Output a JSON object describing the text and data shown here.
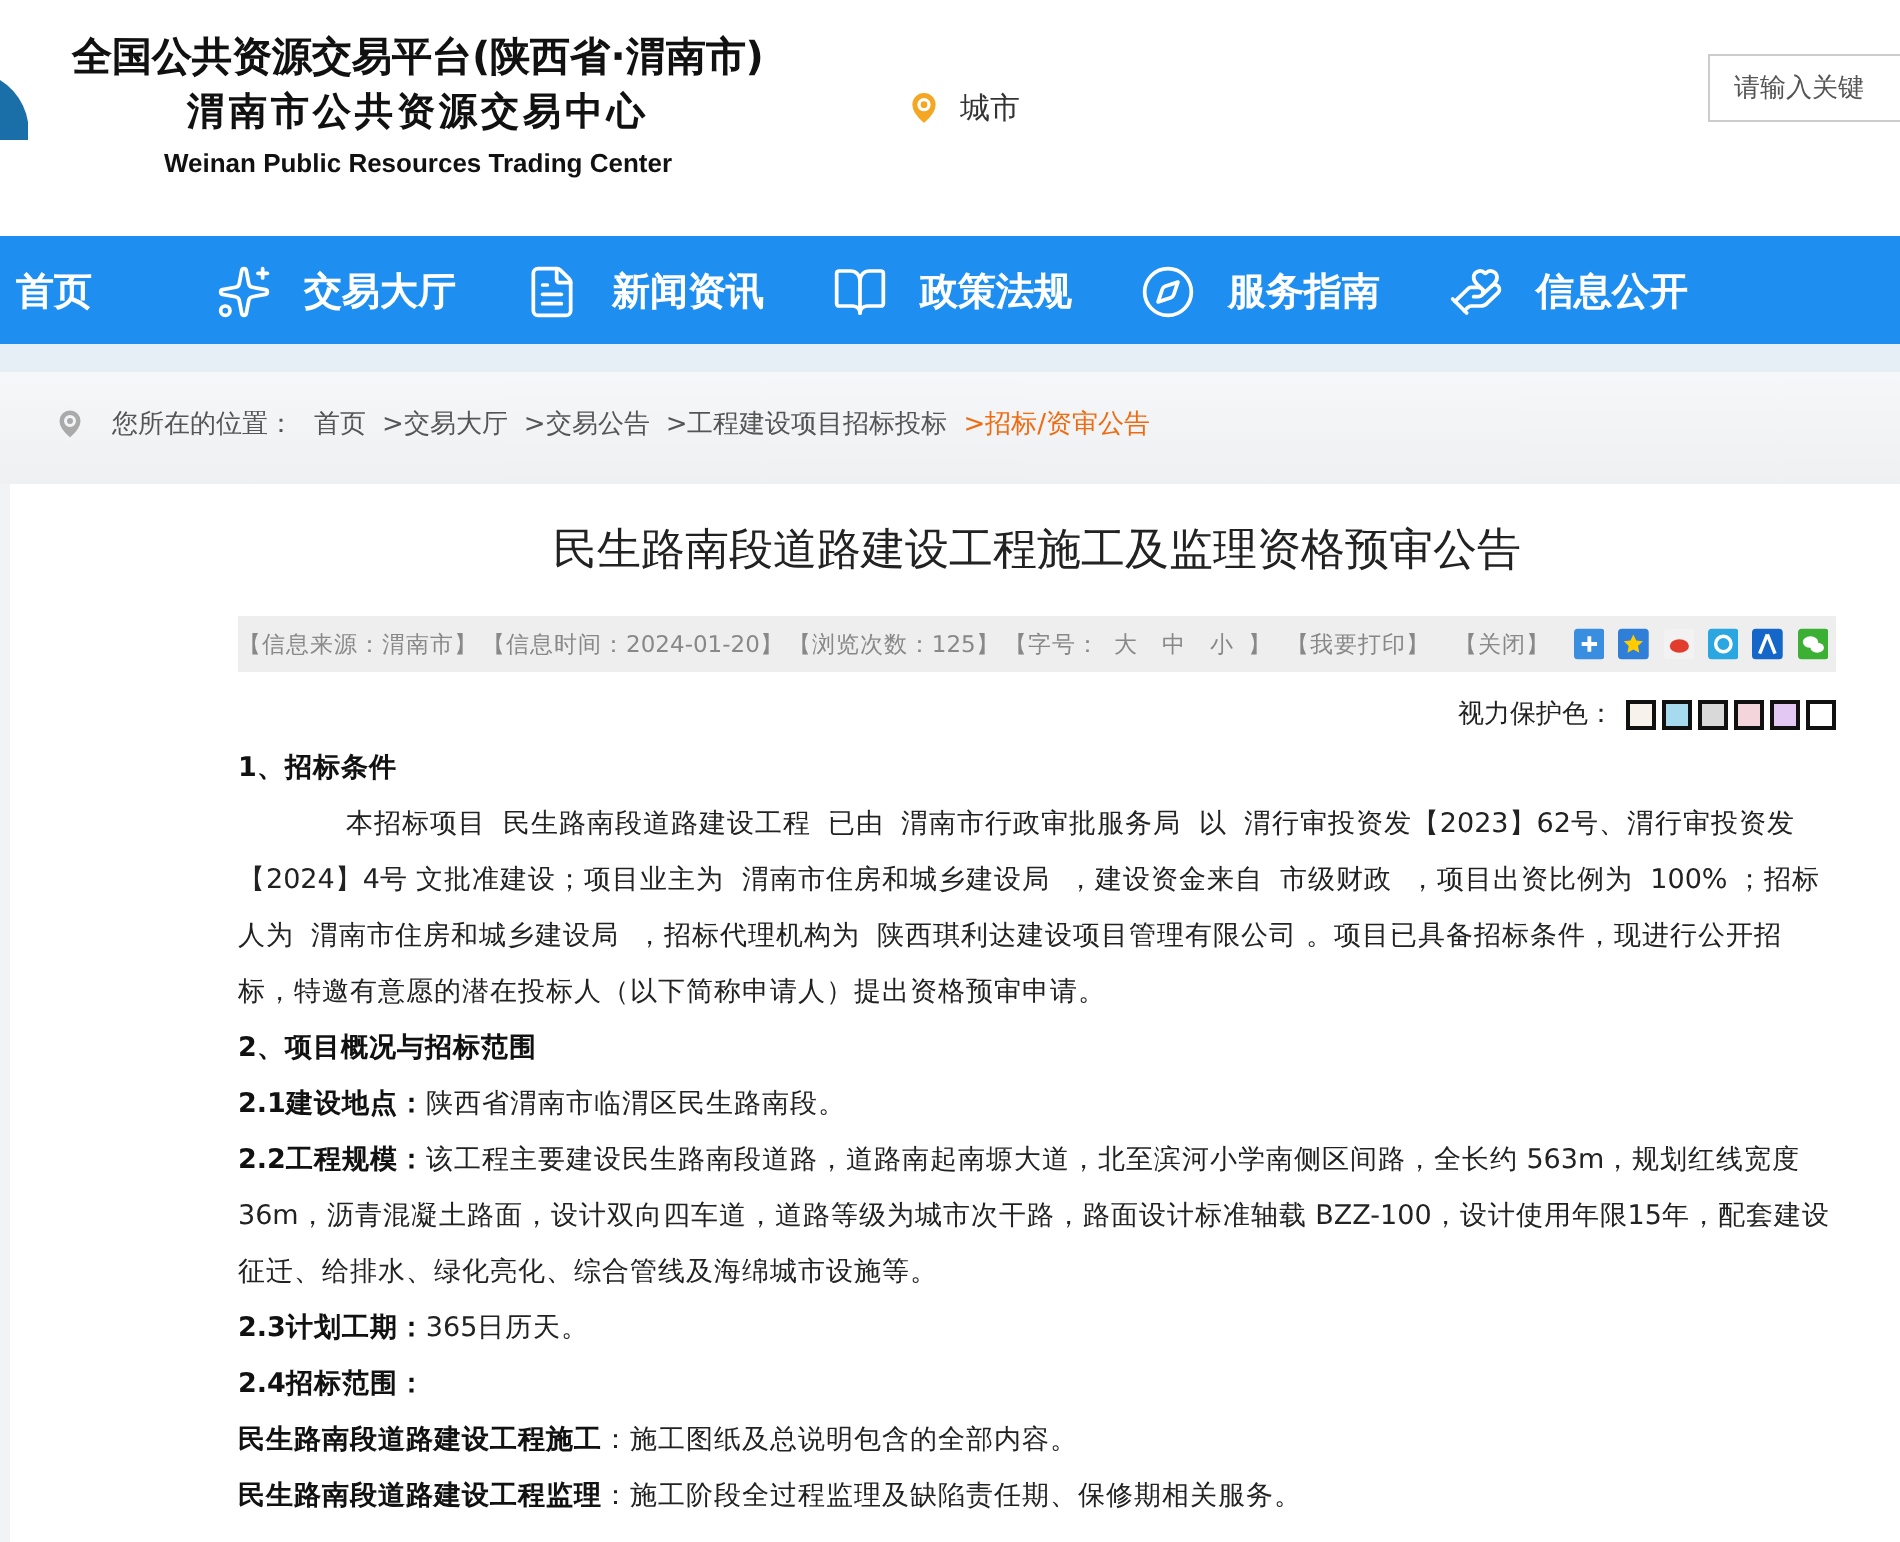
{
  "header": {
    "title_line_1": "全国公共资源交易平台(陕西省·渭南市)",
    "title_line_2": "渭南市公共资源交易中心",
    "title_english": "Weinan Public Resources Trading Center",
    "city": "城市",
    "search": {
      "placeholder": "请输入关键"
    }
  },
  "nav": [
    {
      "label": "首页"
    },
    {
      "label": "交易大厅"
    },
    {
      "label": "新闻资讯"
    },
    {
      "label": "政策法规"
    },
    {
      "label": "服务指南"
    },
    {
      "label": "信息公开"
    }
  ],
  "breadcrumb": {
    "prefix": "您所在的位置：",
    "items": [
      {
        "label": "首页",
        "current": false
      },
      {
        "label": ">交易大厅",
        "current": false
      },
      {
        "label": ">交易公告",
        "current": false
      },
      {
        "label": ">工程建设项目招标投标",
        "current": false
      },
      {
        "label": ">招标/资审公告",
        "current": true
      }
    ]
  },
  "article": {
    "title": "民生路南段道路建设工程施工及监理资格预审公告",
    "meta": [
      "【信息来源：渭南市】",
      "【信息时间：2024-01-20】",
      "【浏览次数：125】"
    ],
    "font_size": {
      "label": "【字号：",
      "options": [
        "大",
        "中",
        "小"
      ],
      "end": "】"
    },
    "actions": [
      "【我要打印】",
      "【关闭】"
    ],
    "eye_care": {
      "label": "视力保护色：",
      "swatches": [
        {
          "color": "#f7f3ec"
        },
        {
          "color": "#a6dbef"
        },
        {
          "color": "#d9d9d9"
        },
        {
          "color": "#f4d5dc"
        },
        {
          "color": "#e2c8f2"
        },
        {
          "color": "#ffffff"
        }
      ]
    },
    "body": [
      {
        "kind": "heading",
        "text": "1、招标条件"
      },
      {
        "kind": "indented",
        "text": "本招标项目  民生路南段道路建设工程  已由  渭南市行政审批服务局  以  渭行审投资发【2023】62号、渭行审投资发【2024】4号 文批准建设；项目业主为  渭南市住房和城乡建设局  ，建设资金来自  市级财政  ，项目出资比例为  100% ；招标人为  渭南市住房和城乡建设局  ，招标代理机构为  陕西琪利达建设项目管理有限公司 。项目已具备招标条件，现进行公开招标，特邀有意愿的潜在投标人（以下简称申请人）提出资格预审申请。"
      },
      {
        "kind": "heading",
        "text": "2、项目概况与招标范围"
      },
      {
        "kind": "paragraph",
        "text": "**2.1建设地点：**陕西省渭南市临渭区民生路南段。"
      },
      {
        "kind": "paragraph",
        "text": "**2.2工程规模：**该工程主要建设民生路南段道路，道路南起南塬大道，北至滨河小学南侧区间路，全长约 563m，规划红线宽度36m，沥青混凝土路面，设计双向四车道，道路等级为城市次干路，路面设计标准轴载 BZZ-100，设计使用年限15年，配套建设征迁、给排水、绿化亮化、综合管线及海绵城市设施等。"
      },
      {
        "kind": "paragraph",
        "text": "**2.3计划工期：**365日历天。"
      },
      {
        "kind": "heading",
        "text": "2.4招标范围："
      },
      {
        "kind": "paragraph",
        "text": "**民生路南段道路建设工程施工**：施工图纸及总说明包含的全部内容。"
      },
      {
        "kind": "paragraph",
        "text": "**民生路南段道路建设工程监理**：施工阶段全过程监理及缺陷责任期、保修期相关服务。"
      }
    ]
  }
}
